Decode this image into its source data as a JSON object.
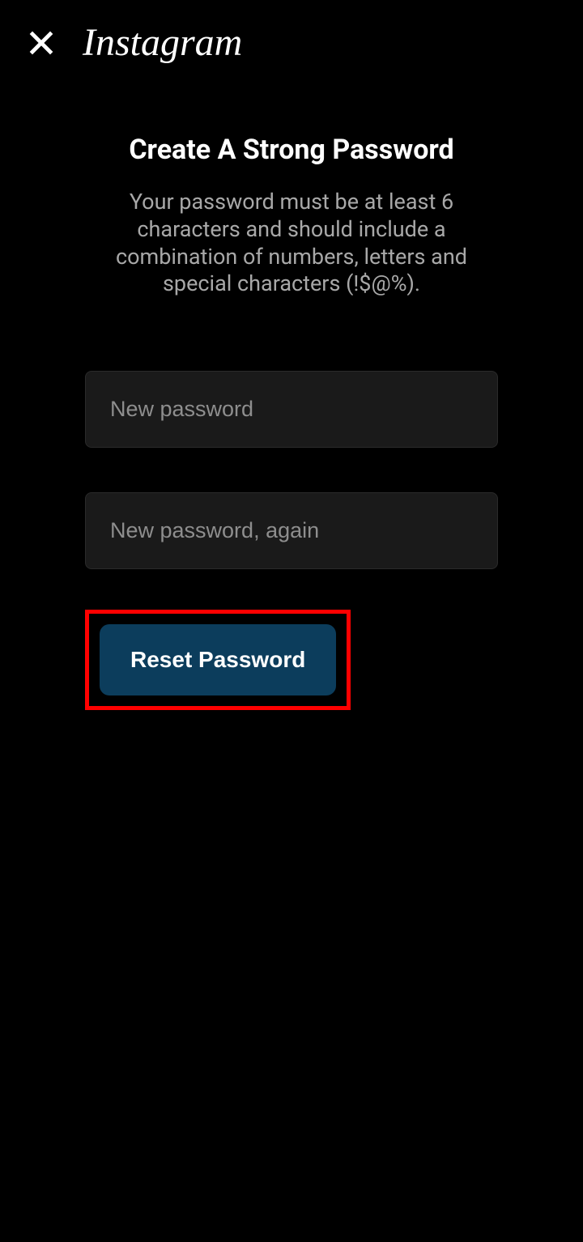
{
  "header": {
    "logo_text": "Instagram"
  },
  "content": {
    "title": "Create A Strong Password",
    "description": "Your password must be at least 6 characters and should include a combination of numbers, letters and special characters (!$@%).",
    "new_password_placeholder": "New password",
    "new_password_again_placeholder": "New password, again",
    "reset_button_label": "Reset Password"
  }
}
